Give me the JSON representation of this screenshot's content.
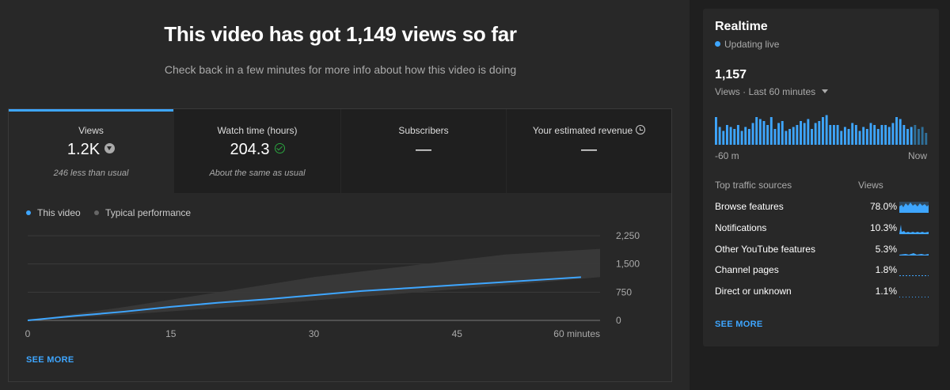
{
  "hero": {
    "title": "This video has got 1,149 views so far",
    "subtitle": "Check back in a few minutes for more info about how this video is doing"
  },
  "tabs": [
    {
      "label": "Views",
      "value": "1.2K",
      "icon": "arrow-down-circle-icon",
      "note": "246 less than usual"
    },
    {
      "label": "Watch time (hours)",
      "value": "204.3",
      "icon": "check-circle-icon",
      "note": "About the same as usual"
    },
    {
      "label": "Subscribers",
      "value": "—",
      "note": ""
    },
    {
      "label": "Your estimated revenue",
      "value": "—",
      "icon": "clock-icon",
      "note": ""
    }
  ],
  "legend": {
    "this_video": "This video",
    "typical": "Typical performance"
  },
  "chart_data": {
    "type": "line",
    "xlabel": "",
    "ylabel": "",
    "x_ticks": [
      "0",
      "15",
      "30",
      "45",
      "60 minutes"
    ],
    "y_ticks": [
      "2,250",
      "1,500",
      "750",
      "0"
    ],
    "xlim": [
      0,
      60
    ],
    "ylim": [
      0,
      2250
    ],
    "series": [
      {
        "name": "This video",
        "x": [
          0,
          5,
          10,
          15,
          20,
          25,
          30,
          35,
          40,
          45,
          50,
          55,
          58
        ],
        "values": [
          0,
          120,
          230,
          360,
          470,
          560,
          670,
          780,
          860,
          940,
          1020,
          1100,
          1149
        ]
      }
    ],
    "band": {
      "name": "Typical performance",
      "x": [
        0,
        10,
        20,
        30,
        40,
        50,
        60
      ],
      "low": [
        0,
        150,
        330,
        530,
        730,
        930,
        1150
      ],
      "high": [
        0,
        350,
        750,
        1150,
        1450,
        1750,
        1900
      ]
    },
    "colors": {
      "line": "#3ea6ff",
      "band": "#3a3a3a"
    },
    "grid": true
  },
  "see_more": "SEE MORE",
  "realtime": {
    "title": "Realtime",
    "live": "Updating live",
    "count": "1,157",
    "period": "Views · Last 60 minutes",
    "axis_start": "-60 m",
    "axis_end": "Now",
    "bars": [
      28,
      18,
      14,
      20,
      18,
      16,
      20,
      14,
      18,
      16,
      22,
      28,
      26,
      24,
      20,
      28,
      16,
      22,
      24,
      14,
      16,
      18,
      20,
      24,
      22,
      26,
      16,
      22,
      24,
      28,
      30,
      20,
      20,
      20,
      14,
      18,
      16,
      22,
      20,
      14,
      18,
      16,
      22,
      20,
      16,
      20,
      20,
      18,
      22,
      28,
      26,
      20,
      16,
      18,
      20,
      16,
      18,
      12
    ]
  },
  "traffic": {
    "header_label": "Top traffic sources",
    "header_value": "Views",
    "rows": [
      {
        "name": "Browse features",
        "pct": "78.0%"
      },
      {
        "name": "Notifications",
        "pct": "10.3%"
      },
      {
        "name": "Other YouTube features",
        "pct": "5.3%"
      },
      {
        "name": "Channel pages",
        "pct": "1.8%"
      },
      {
        "name": "Direct or unknown",
        "pct": "1.1%"
      }
    ]
  }
}
